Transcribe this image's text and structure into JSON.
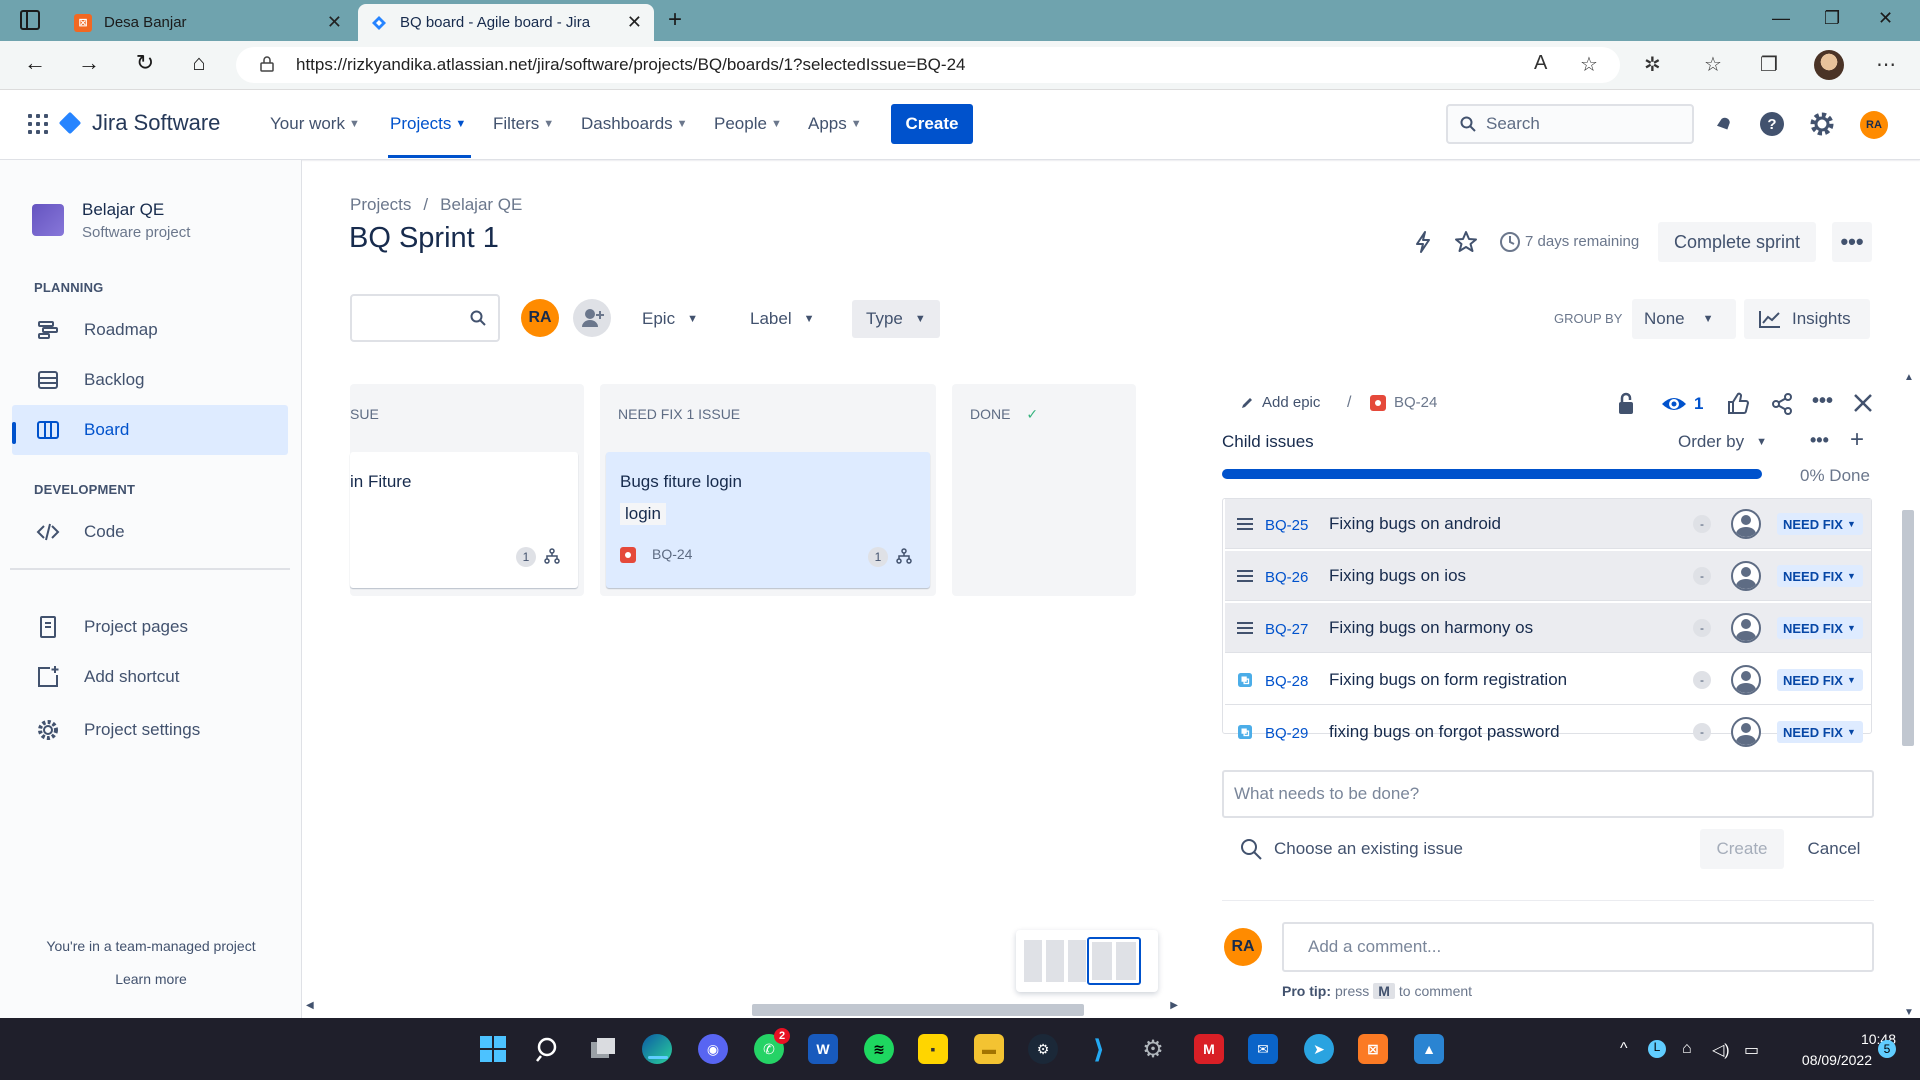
{
  "browser": {
    "tabs": [
      {
        "title": "Desa Banjar",
        "active": false
      },
      {
        "title": "BQ board - Agile board - Jira",
        "active": true
      }
    ],
    "url": "https://rizkyandika.atlassian.net/jira/software/projects/BQ/boards/1?selectedIssue=BQ-24"
  },
  "jira_nav": {
    "product": "Jira Software",
    "items": [
      "Your work",
      "Projects",
      "Filters",
      "Dashboards",
      "People",
      "Apps"
    ],
    "create_label": "Create",
    "search_placeholder": "Search",
    "user_initials": "RA"
  },
  "sidebar": {
    "project_name": "Belajar QE",
    "project_type": "Software project",
    "planning_header": "PLANNING",
    "planning_items": [
      "Roadmap",
      "Backlog",
      "Board"
    ],
    "development_header": "DEVELOPMENT",
    "development_items": [
      "Code"
    ],
    "other_items": [
      "Project pages",
      "Add shortcut",
      "Project settings"
    ],
    "footer_text": "You're in a team-managed project",
    "learn_more": "Learn more"
  },
  "board": {
    "breadcrumb": [
      "Projects",
      "/",
      "Belajar QE"
    ],
    "title": "BQ Sprint 1",
    "days_remaining": "7 days remaining",
    "complete_sprint": "Complete sprint",
    "more": "•••",
    "filters": {
      "avatar": "RA",
      "epic": "Epic",
      "label": "Label",
      "type": "Type",
      "group_by_label": "GROUP BY",
      "group_by_value": "None",
      "insights": "Insights"
    },
    "columns": [
      {
        "title": "SUE",
        "card": {
          "title": "in Fiture",
          "count": "1"
        }
      },
      {
        "title": "NEED FIX 1 ISSUE",
        "card": {
          "title": "Bugs fiture login",
          "label": "login",
          "key": "BQ-24",
          "count": "1"
        }
      },
      {
        "title": "DONE",
        "check": "✓"
      }
    ]
  },
  "issue_panel": {
    "add_epic": "Add epic",
    "separator": "/",
    "issue_key": "BQ-24",
    "watch_count": "1",
    "child_header": "Child issues",
    "order_by": "Order by",
    "progress_percent": 0,
    "progress_text": "0% Done",
    "children": [
      {
        "key": "BQ-25",
        "title": "Fixing bugs on android",
        "priority": "-",
        "status": "NEED FIX",
        "type": "story-lines"
      },
      {
        "key": "BQ-26",
        "title": "Fixing bugs on ios",
        "priority": "-",
        "status": "NEED FIX",
        "type": "story-lines"
      },
      {
        "key": "BQ-27",
        "title": "Fixing bugs on harmony os",
        "priority": "-",
        "status": "NEED FIX",
        "type": "story-lines"
      },
      {
        "key": "BQ-28",
        "title": "Fixing bugs on form registration",
        "priority": "-",
        "status": "NEED FIX",
        "type": "subtask"
      },
      {
        "key": "BQ-29",
        "title": "fixing bugs on forgot password",
        "priority": "-",
        "status": "NEED FIX",
        "type": "subtask"
      }
    ],
    "new_child_placeholder": "What needs to be done?",
    "choose_existing": "Choose an existing issue",
    "create": "Create",
    "cancel": "Cancel",
    "comment_avatar": "RA",
    "comment_placeholder": "Add a comment...",
    "pro_tip_label": "Pro tip:",
    "pro_tip_press": "press",
    "pro_tip_key": "M",
    "pro_tip_suffix": "to comment"
  },
  "taskbar": {
    "time": "10:48",
    "date": "08/09/2022",
    "notification_count": "5",
    "whatsapp_badge": "2"
  },
  "colors": {
    "jira_blue": "#0052cc",
    "bug_red": "#e5493a",
    "avatar_orange": "#ff8b00"
  }
}
